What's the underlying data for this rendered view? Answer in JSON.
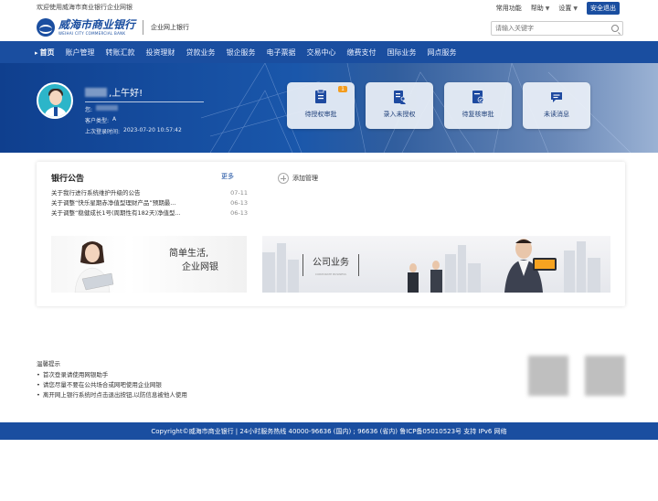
{
  "topbar": {
    "welcome": "欢迎使用威海市商业银行企业网银",
    "links": [
      {
        "label": "常用功能",
        "caret": false
      },
      {
        "label": "帮助",
        "caret": true
      },
      {
        "label": "设置",
        "caret": true
      }
    ],
    "logout": "安全退出"
  },
  "header": {
    "logo_cn": "威海市商业银行",
    "logo_en": "WEIHAI CITY COMMERCIAL BANK",
    "logo_sub": "企业网上银行",
    "search_placeholder": "请输入关键字"
  },
  "nav": {
    "items": [
      "首页",
      "账户管理",
      "转账汇款",
      "投资理财",
      "贷款业务",
      "银企服务",
      "电子票据",
      "交易中心",
      "缴费支付",
      "国际业务",
      "网点服务"
    ],
    "active_index": 0
  },
  "hero": {
    "greeting": ",上午好!",
    "role_label": "您:",
    "category_label": "客户类型:",
    "category_value": "A",
    "last_login_label": "上次登录时间:",
    "last_login_value": "2023-07-20 10:57:42",
    "quick_actions": [
      {
        "label": "待授权审批",
        "badge": "1"
      },
      {
        "label": "录入未授权",
        "badge": ""
      },
      {
        "label": "待复核审批",
        "badge": ""
      },
      {
        "label": "未读消息",
        "badge": ""
      }
    ]
  },
  "notices": {
    "title": "银行公告",
    "more": "更多",
    "items": [
      {
        "text": "关于我行进行系统维护升级的公告",
        "date": "07-11"
      },
      {
        "text": "关于调整“快乐星期赤净值型理财产品”预期最...",
        "date": "06-13"
      },
      {
        "text": "关于调整“稳健成长1号(周期性有182天)净值型...",
        "date": "06-13"
      }
    ]
  },
  "add_mgmt": "添加管理",
  "banner1": {
    "line1": "简单生活,",
    "line2": "企业网银"
  },
  "banner2": {
    "title": "公司业务",
    "subtitle": "CORPORATE BUSINESS"
  },
  "tips": {
    "title": "温馨提示",
    "items": [
      "首次登录请使用网银助手",
      "请您尽量不要在公共场合或网吧使用企业网银",
      "离开网上银行系统时点击退出按钮,以防信息被他人使用"
    ]
  },
  "footer": {
    "text": "Copyright©威海市商业银行 | 24小时服务热线 40000-96636 (国内) ; 96636 (省内)    鲁ICP备05010523号    支持 IPv6 网络"
  },
  "colors": {
    "brand_blue": "#1a4ea0",
    "badge_orange": "#f39c1e",
    "hero_teal": "#2cb5c9"
  }
}
